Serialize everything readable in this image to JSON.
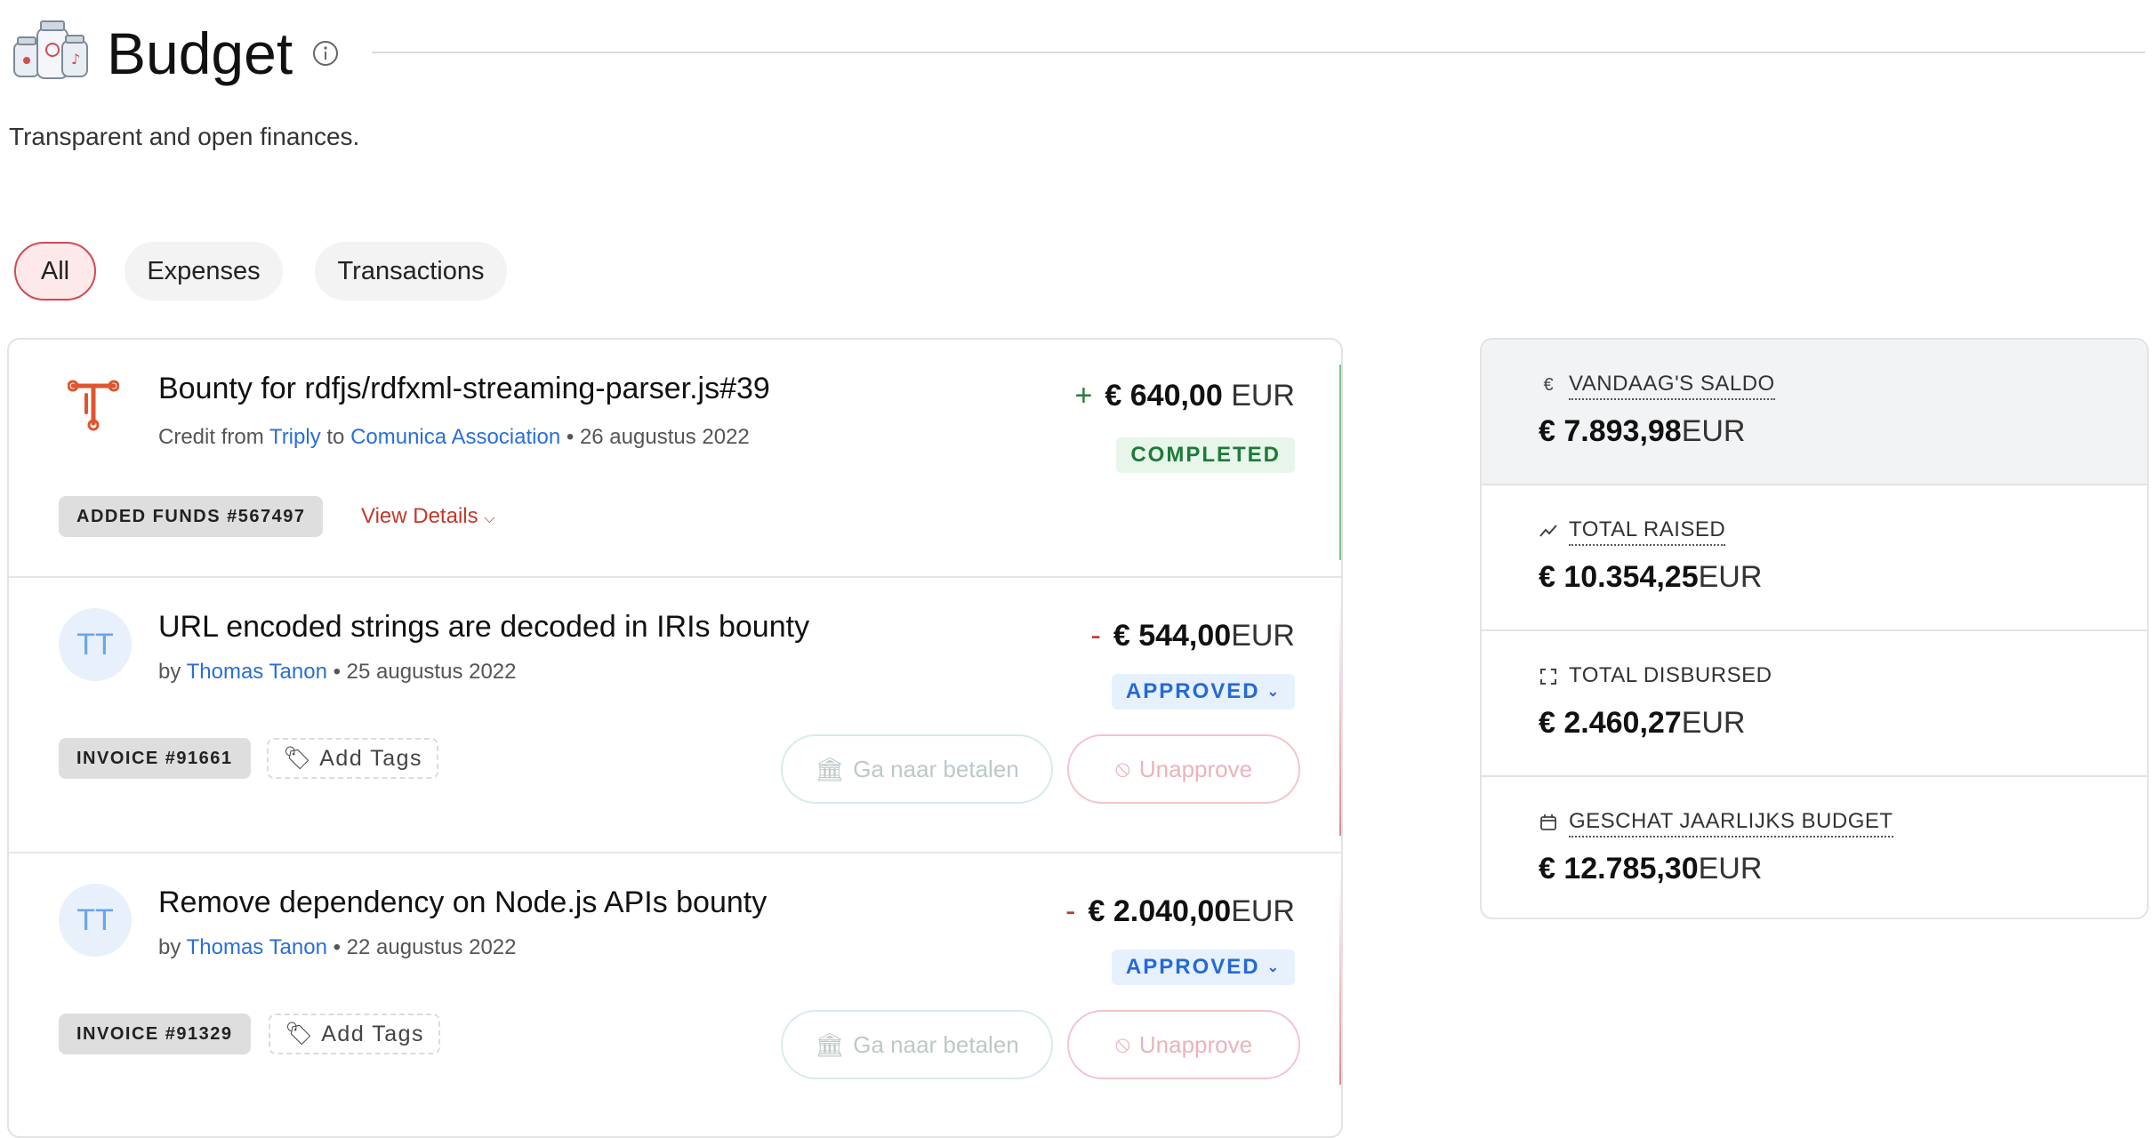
{
  "header": {
    "title": "Budget",
    "subtitle": "Transparent and open finances."
  },
  "tabs": [
    {
      "label": "All",
      "active": true
    },
    {
      "label": "Expenses",
      "active": false
    },
    {
      "label": "Transactions",
      "active": false
    }
  ],
  "items": [
    {
      "title": "Bounty for rdfjs/rdfxml-streaming-parser.js#39",
      "meta_prefix": "Credit from",
      "from": "Triply",
      "to_word": "to",
      "to": "Comunica Association",
      "date": "26 augustus 2022",
      "sign": "+",
      "amount": "€ 640,00",
      "currency": "EUR",
      "status": "COMPLETED",
      "badge": "ADDED FUNDS #567497",
      "view_details": "View Details"
    },
    {
      "avatar": "TT",
      "title": "URL encoded strings are decoded in IRIs bounty",
      "by_word": "by",
      "author": "Thomas Tanon",
      "date": "25 augustus 2022",
      "sign": "-",
      "amount": "€ 544,00",
      "currency": "EUR",
      "status": "APPROVED",
      "badge": "INVOICE #91661",
      "add_tags": "Add Tags",
      "pay_label": "Ga naar betalen",
      "unapprove_label": "Unapprove"
    },
    {
      "avatar": "TT",
      "title": "Remove dependency on Node.js APIs bounty",
      "by_word": "by",
      "author": "Thomas Tanon",
      "date": "22 augustus 2022",
      "sign": "-",
      "amount": "€ 2.040,00",
      "currency": "EUR",
      "status": "APPROVED",
      "badge": "INVOICE #91329",
      "add_tags": "Add Tags",
      "pay_label": "Ga naar betalen",
      "unapprove_label": "Unapprove"
    }
  ],
  "summary": [
    {
      "icon": "euro-icon",
      "label": "VANDAAG'S SALDO",
      "value": "€ 7.893,98",
      "currency": "EUR"
    },
    {
      "icon": "trending-up-icon",
      "label": "TOTAL RAISED",
      "value": "€ 10.354,25",
      "currency": "EUR"
    },
    {
      "icon": "expand-icon",
      "label": "TOTAL DISBURSED",
      "value": "€ 2.460,27",
      "currency": "EUR"
    },
    {
      "icon": "calendar-icon",
      "label": "GESCHAT JAARLIJKS BUDGET",
      "value": "€ 12.785,30",
      "currency": "EUR"
    }
  ],
  "colors": {
    "accent_red": "#c0392b",
    "link_blue": "#2a6fd6",
    "completed_green": "#1f7a3a",
    "approved_blue": "#2569d6"
  }
}
